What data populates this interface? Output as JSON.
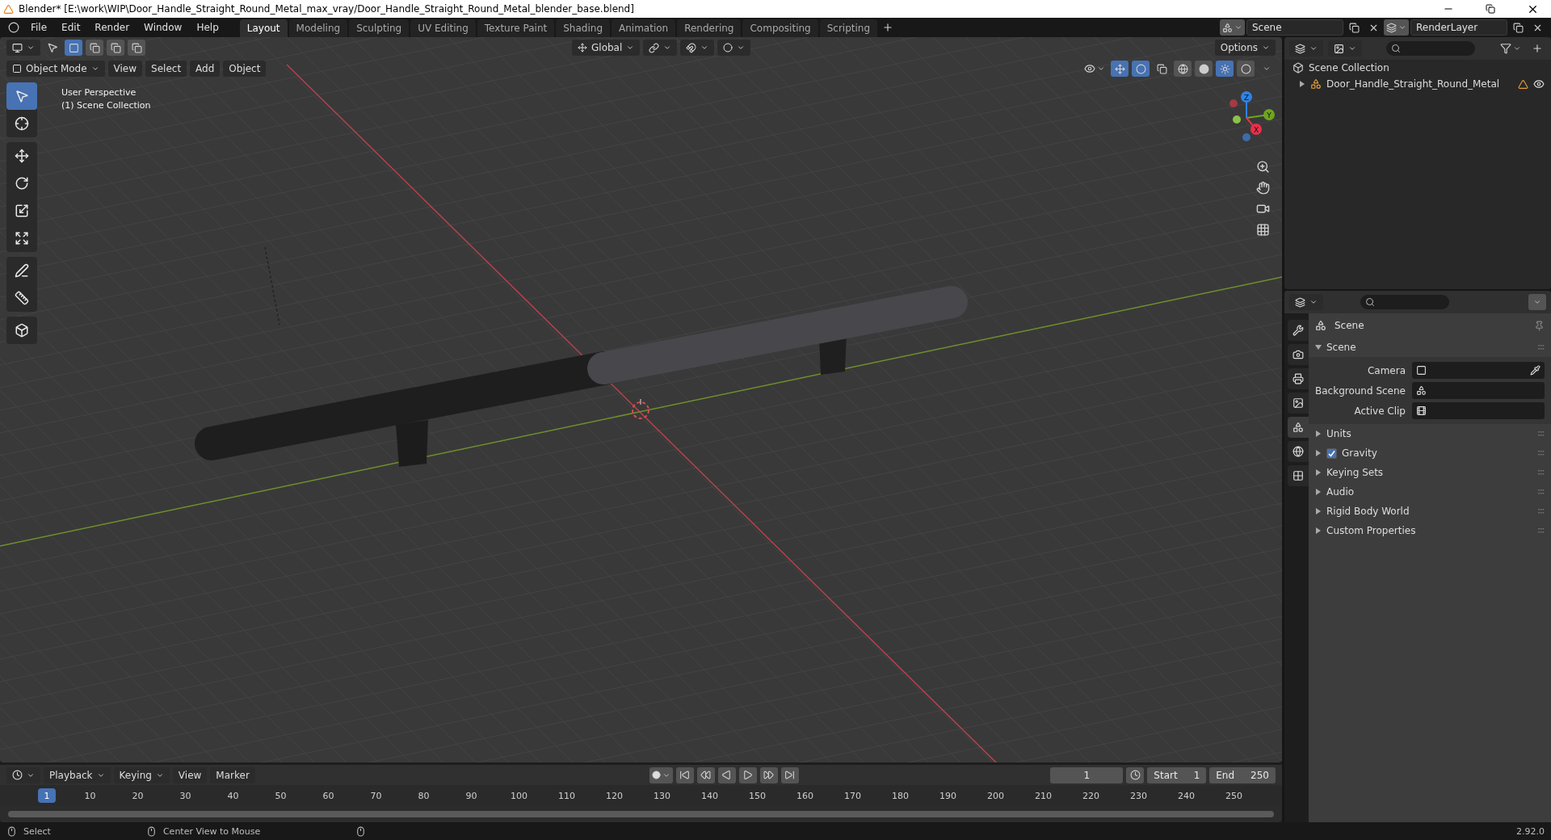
{
  "title_bar": {
    "title": "Blender* [E:\\work\\WIP\\Door_Handle_Straight_Round_Metal_max_vray/Door_Handle_Straight_Round_Metal_blender_base.blend]"
  },
  "menu": [
    "File",
    "Edit",
    "Render",
    "Window",
    "Help"
  ],
  "workspace_tabs": [
    {
      "label": "Layout",
      "selected": true
    },
    {
      "label": "Modeling",
      "selected": false
    },
    {
      "label": "Sculpting",
      "selected": false
    },
    {
      "label": "UV Editing",
      "selected": false
    },
    {
      "label": "Texture Paint",
      "selected": false
    },
    {
      "label": "Shading",
      "selected": false
    },
    {
      "label": "Animation",
      "selected": false
    },
    {
      "label": "Rendering",
      "selected": false
    },
    {
      "label": "Compositing",
      "selected": false
    },
    {
      "label": "Scripting",
      "selected": false
    }
  ],
  "scene_field": "Scene",
  "view_layer_field": "RenderLayer",
  "viewport": {
    "transform_orientation": "Global",
    "options": "Options",
    "mode": "Object Mode",
    "menus": [
      "View",
      "Select",
      "Add",
      "Object"
    ],
    "overlay_text": [
      "User Perspective",
      "(1) Scene Collection"
    ],
    "tools": [
      {
        "kind": "select",
        "selected": true
      },
      {
        "kind": "cursor",
        "selected": false
      },
      {
        "kind": "move",
        "selected": false
      },
      {
        "kind": "rotate",
        "selected": false
      },
      {
        "kind": "scale",
        "selected": false
      },
      {
        "kind": "transform",
        "selected": false
      },
      {
        "kind": "annotate",
        "selected": false
      },
      {
        "kind": "measure",
        "selected": false
      },
      {
        "kind": "add-cube",
        "selected": false
      }
    ],
    "gizmo_axes": [
      {
        "label": "Z",
        "color": "#2f83e6"
      },
      {
        "label": "Y",
        "color": "#6fa51e"
      },
      {
        "label": "X",
        "color": "#e8304a"
      }
    ]
  },
  "outliner": {
    "root": "Scene Collection",
    "children": [
      {
        "label": "Door_Handle_Straight_Round_Metal",
        "expanded": false
      }
    ]
  },
  "properties": {
    "tabs": [
      {
        "kind": "tool",
        "selected": false
      },
      {
        "kind": "render",
        "selected": false
      },
      {
        "kind": "output",
        "selected": false
      },
      {
        "kind": "view-layer",
        "selected": false
      },
      {
        "kind": "scene",
        "selected": true
      },
      {
        "kind": "world",
        "selected": false
      },
      {
        "kind": "texture",
        "selected": false
      }
    ],
    "context": "Scene",
    "panel": {
      "label": "Scene",
      "expanded": true,
      "fields": [
        {
          "label": "Camera",
          "kind": "camera"
        },
        {
          "label": "Background Scene",
          "kind": "scene"
        },
        {
          "label": "Active Clip",
          "kind": "clip"
        }
      ]
    },
    "sections": [
      {
        "label": "Units",
        "kind": "plain"
      },
      {
        "label": "Gravity",
        "kind": "checkbox",
        "checked": true
      },
      {
        "label": "Keying Sets",
        "kind": "plain"
      },
      {
        "label": "Audio",
        "kind": "plain"
      },
      {
        "label": "Rigid Body World",
        "kind": "plain"
      },
      {
        "label": "Custom Properties",
        "kind": "plain"
      }
    ]
  },
  "timeline": {
    "menus": [
      "Playback",
      "Keying",
      "View",
      "Marker"
    ],
    "current_frame": "1",
    "start_label": "Start",
    "start": "1",
    "end_label": "End",
    "end": "250",
    "playhead": "1",
    "ticks": [
      "10",
      "20",
      "30",
      "40",
      "50",
      "60",
      "70",
      "80",
      "90",
      "100",
      "110",
      "120",
      "130",
      "140",
      "150",
      "160",
      "170",
      "180",
      "190",
      "200",
      "210",
      "220",
      "230",
      "240",
      "250"
    ]
  },
  "status_bar": {
    "items": [
      "Select",
      "Center View to Mouse"
    ],
    "version": "2.92.0"
  }
}
